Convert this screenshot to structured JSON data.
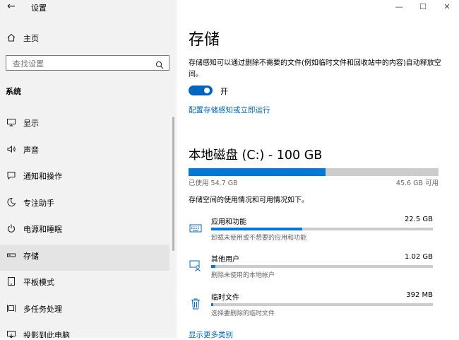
{
  "window": {
    "title": "设置",
    "minimize": "—",
    "maximize": "☐",
    "close": "✕"
  },
  "sidebar": {
    "back_icon": "back-arrow-icon",
    "home_label": "主页",
    "search_placeholder": "查找设置",
    "section_title": "系统",
    "items": [
      {
        "label": "显示",
        "icon": "display-icon"
      },
      {
        "label": "声音",
        "icon": "sound-icon"
      },
      {
        "label": "通知和操作",
        "icon": "notification-icon"
      },
      {
        "label": "专注助手",
        "icon": "moon-icon"
      },
      {
        "label": "电源和睡眠",
        "icon": "power-icon"
      },
      {
        "label": "存储",
        "icon": "storage-icon",
        "active": true
      },
      {
        "label": "平板模式",
        "icon": "tablet-icon"
      },
      {
        "label": "多任务处理",
        "icon": "multitask-icon"
      },
      {
        "label": "投影到此电脑",
        "icon": "project-icon"
      }
    ]
  },
  "main": {
    "title": "存储",
    "description": "存储感知可以通过删除不需要的文件(例如临时文件和回收站中的内容)自动释放空间。",
    "toggle_state": "开",
    "toggle_on": true,
    "config_link": "配置存储感知或立即运行",
    "disk_title": "本地磁盘 (C:) - 100 GB",
    "disk_used_fraction": 0.547,
    "used_text": "已使用 54.7 GB",
    "available_text": "45.6 GB 可用",
    "usage_description": "存储空间的使用情况和可用情况如下。",
    "categories": [
      {
        "name": "应用和功能",
        "size": "22.5 GB",
        "fraction": 0.41,
        "subtitle": "卸载未使用或不想要的应用和功能",
        "icon": "keyboard-icon"
      },
      {
        "name": "其他用户",
        "size": "1.02 GB",
        "fraction": 0.02,
        "subtitle": "删除未使用的本地帐户",
        "icon": "users-icon"
      },
      {
        "name": "临时文件",
        "size": "392 MB",
        "fraction": 0.008,
        "subtitle": "选择要删除的临时文件",
        "icon": "trash-icon"
      }
    ],
    "more_link": "显示更多类别"
  },
  "colors": {
    "accent": "#0078d7",
    "link": "#0067c0",
    "sidebar_bg": "#f2f2f2"
  }
}
